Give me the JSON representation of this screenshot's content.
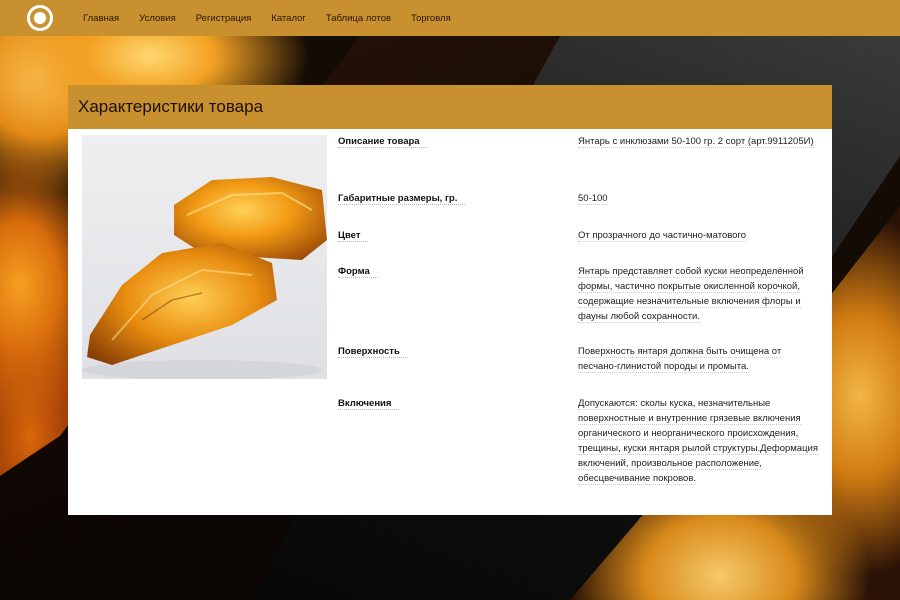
{
  "nav": {
    "items": [
      "Главная",
      "Условия",
      "Регистрация",
      "Каталог",
      "Таблица лотов",
      "Торговля"
    ]
  },
  "card": {
    "title": "Характеристики товара",
    "specs": [
      {
        "label": "Описание товара",
        "value": "Янтарь с инклюзами 50-100 гр. 2 сорт (арт.9911205И)"
      },
      {
        "label": "Габаритные размеры, гр.",
        "value": "50-100"
      },
      {
        "label": "Цвет",
        "value": "От прозрачного до частично-матового"
      },
      {
        "label": "Форма",
        "value": "Янтарь представляет собой куски неопределённой формы, частично покрытые окисленной корочкой, содержащие незначительные включения флоры и фауны любой сохранности."
      },
      {
        "label": "Поверхность",
        "value": "Поверхность янтаря должна быть очищена от песчано-глинистой породы и промыта."
      },
      {
        "label": "Включения",
        "value": "Допускаются: сколы куска, незначительные поверхностные и внутренние грязевые включения органического и неорганического происхождения, трещины, куски янтаря рылой структуры.Деформация включений, произвольное расположение, обесцвечивание покровов."
      }
    ]
  },
  "colors": {
    "accent": "#c8902f",
    "card_bg": "#ffffff"
  }
}
